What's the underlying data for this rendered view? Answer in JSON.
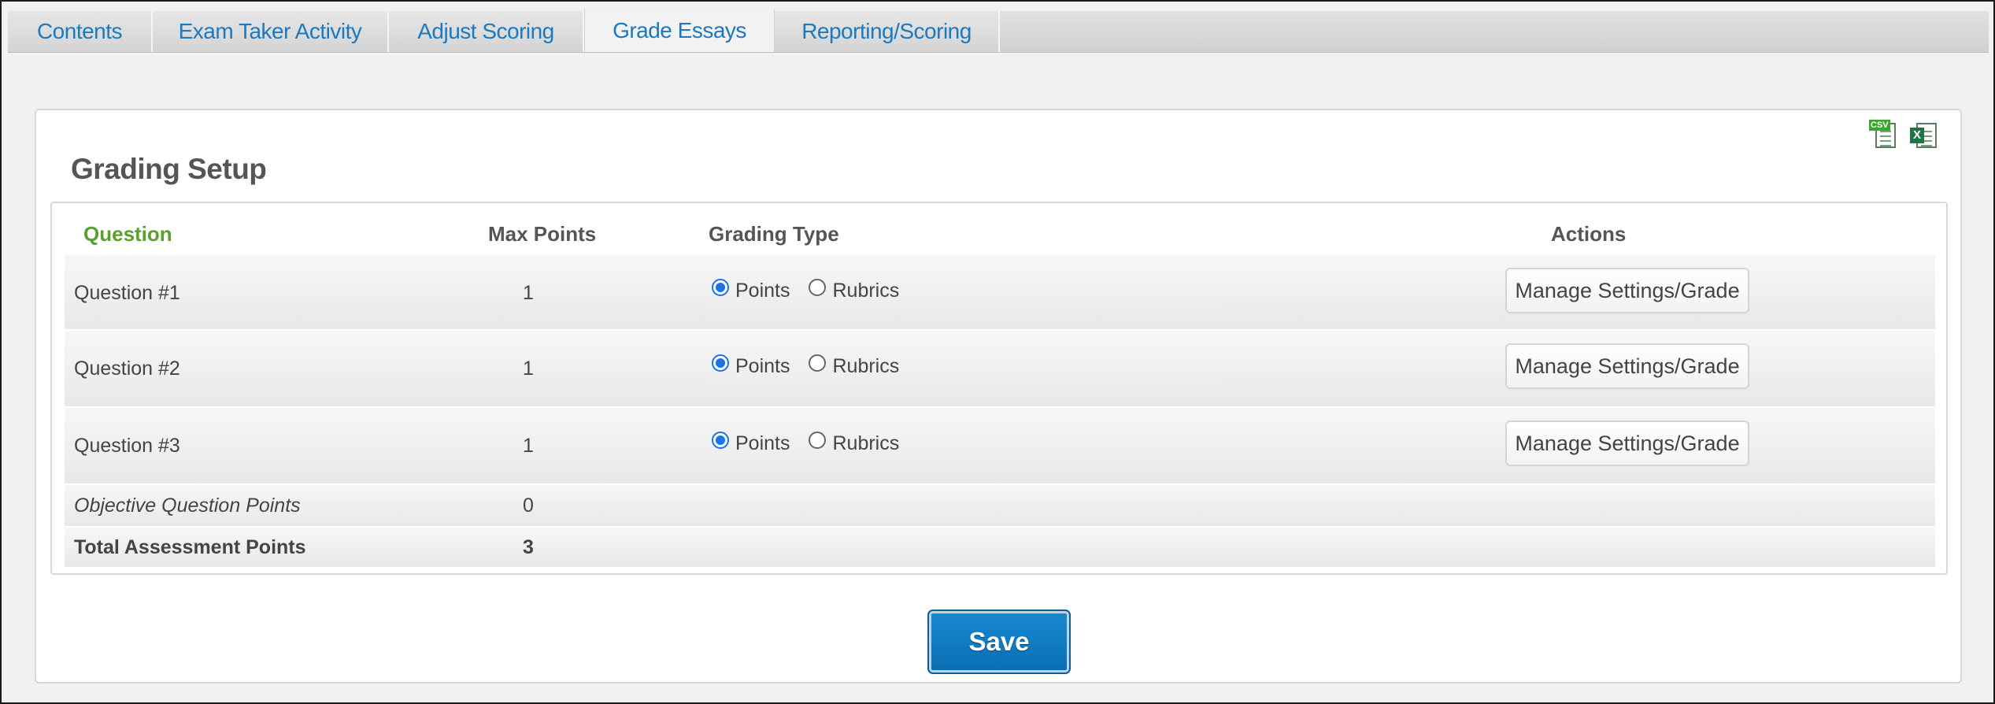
{
  "tabs": [
    {
      "label": "Contents",
      "active": false
    },
    {
      "label": "Exam Taker Activity",
      "active": false
    },
    {
      "label": "Adjust Scoring",
      "active": false
    },
    {
      "label": "Grade Essays",
      "active": true
    },
    {
      "label": "Reporting/Scoring",
      "active": false
    }
  ],
  "panel": {
    "title": "Grading Setup",
    "export": {
      "csv_tag": "CSV",
      "excel_tag": "X"
    }
  },
  "table": {
    "headers": {
      "question": "Question",
      "max_points": "Max Points",
      "grading_type": "Grading Type",
      "actions": "Actions"
    },
    "rows": [
      {
        "question": "Question #1",
        "max_points": "1",
        "points_label": "Points",
        "rubrics_label": "Rubrics",
        "selected": "points",
        "action_label": "Manage Settings/Grade"
      },
      {
        "question": "Question #2",
        "max_points": "1",
        "points_label": "Points",
        "rubrics_label": "Rubrics",
        "selected": "points",
        "action_label": "Manage Settings/Grade"
      },
      {
        "question": "Question #3",
        "max_points": "1",
        "points_label": "Points",
        "rubrics_label": "Rubrics",
        "selected": "points",
        "action_label": "Manage Settings/Grade"
      }
    ],
    "objective": {
      "label": "Objective Question Points",
      "value": "0"
    },
    "total": {
      "label": "Total Assessment Points",
      "value": "3"
    }
  },
  "save_label": "Save",
  "colors": {
    "tab_text": "#1b79c0",
    "question_header": "#5aa02c",
    "save_bg": "#0a7ac2"
  }
}
